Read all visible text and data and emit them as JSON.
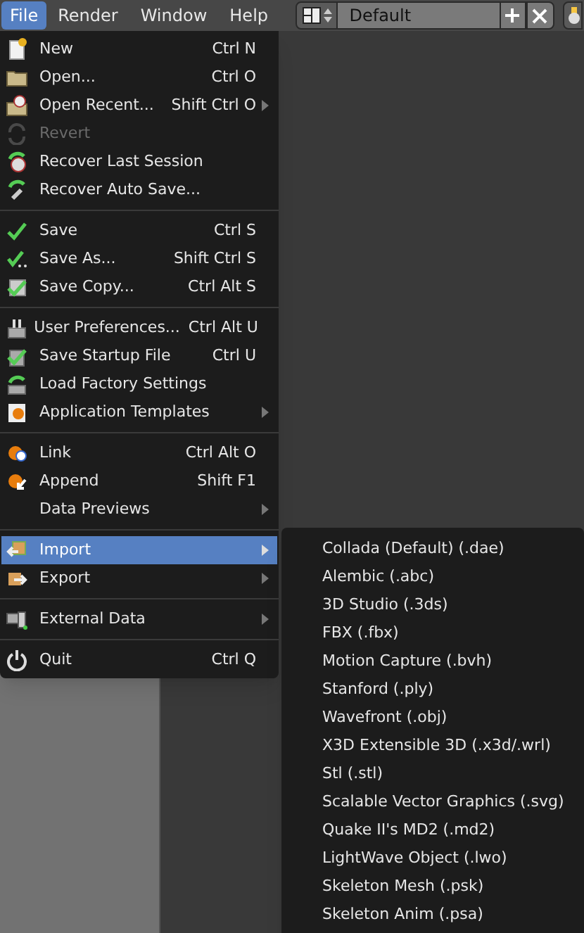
{
  "menu_bar": [
    {
      "label": "File",
      "selected": true
    },
    {
      "label": "Render",
      "selected": false
    },
    {
      "label": "Window",
      "selected": false
    },
    {
      "label": "Help",
      "selected": false
    }
  ],
  "layout_selector": {
    "value": "Default"
  },
  "file_menu": {
    "sections": [
      {
        "items": [
          {
            "label": "New",
            "shortcut": "Ctrl N",
            "submenu": false,
            "disabled": false,
            "selected": false
          },
          {
            "label": "Open...",
            "shortcut": "Ctrl O",
            "submenu": false,
            "disabled": false,
            "selected": false
          },
          {
            "label": "Open Recent...",
            "shortcut": "Shift Ctrl O",
            "submenu": true,
            "disabled": false,
            "selected": false
          },
          {
            "label": "Revert",
            "submenu": false,
            "disabled": true,
            "selected": false
          },
          {
            "label": "Recover Last Session",
            "submenu": false,
            "disabled": false,
            "selected": false
          },
          {
            "label": "Recover Auto Save...",
            "submenu": false,
            "disabled": false,
            "selected": false
          }
        ]
      },
      {
        "items": [
          {
            "label": "Save",
            "shortcut": "Ctrl S",
            "submenu": false,
            "disabled": false,
            "selected": false
          },
          {
            "label": "Save As...",
            "shortcut": "Shift Ctrl S",
            "submenu": false,
            "disabled": false,
            "selected": false
          },
          {
            "label": "Save Copy...",
            "shortcut": "Ctrl Alt S",
            "submenu": false,
            "disabled": false,
            "selected": false
          }
        ]
      },
      {
        "items": [
          {
            "label": "User Preferences...",
            "shortcut": "Ctrl Alt U",
            "submenu": false,
            "disabled": false,
            "selected": false
          },
          {
            "label": "Save Startup File",
            "shortcut": "Ctrl U",
            "submenu": false,
            "disabled": false,
            "selected": false
          },
          {
            "label": "Load Factory Settings",
            "submenu": false,
            "disabled": false,
            "selected": false
          },
          {
            "label": "Application Templates",
            "submenu": true,
            "disabled": false,
            "selected": false
          }
        ]
      },
      {
        "items": [
          {
            "label": "Link",
            "shortcut": "Ctrl Alt O",
            "submenu": false,
            "disabled": false,
            "selected": false
          },
          {
            "label": "Append",
            "shortcut": "Shift F1",
            "submenu": false,
            "disabled": false,
            "selected": false
          },
          {
            "label": "Data Previews",
            "submenu": true,
            "disabled": false,
            "selected": false
          }
        ]
      },
      {
        "items": [
          {
            "label": "Import",
            "submenu": true,
            "disabled": false,
            "selected": true
          },
          {
            "label": "Export",
            "submenu": true,
            "disabled": false,
            "selected": false
          }
        ]
      },
      {
        "items": [
          {
            "label": "External Data",
            "submenu": true,
            "disabled": false,
            "selected": false
          }
        ]
      },
      {
        "items": [
          {
            "label": "Quit",
            "shortcut": "Ctrl Q",
            "submenu": false,
            "disabled": false,
            "selected": false
          }
        ]
      }
    ]
  },
  "import_submenu": {
    "items": [
      {
        "label": "Collada (Default) (.dae)"
      },
      {
        "label": "Alembic (.abc)"
      },
      {
        "label": "3D Studio (.3ds)"
      },
      {
        "label": "FBX (.fbx)"
      },
      {
        "label": "Motion Capture (.bvh)"
      },
      {
        "label": "Stanford (.ply)"
      },
      {
        "label": "Wavefront (.obj)"
      },
      {
        "label": "X3D Extensible 3D (.x3d/.wrl)"
      },
      {
        "label": "Stl (.stl)"
      },
      {
        "label": "Scalable Vector Graphics (.svg)"
      },
      {
        "label": "Quake II's MD2 (.md2)"
      },
      {
        "label": "LightWave Object (.lwo)"
      },
      {
        "label": "Skeleton Mesh (.psk)"
      },
      {
        "label": "Skeleton Anim (.psa)"
      }
    ]
  }
}
